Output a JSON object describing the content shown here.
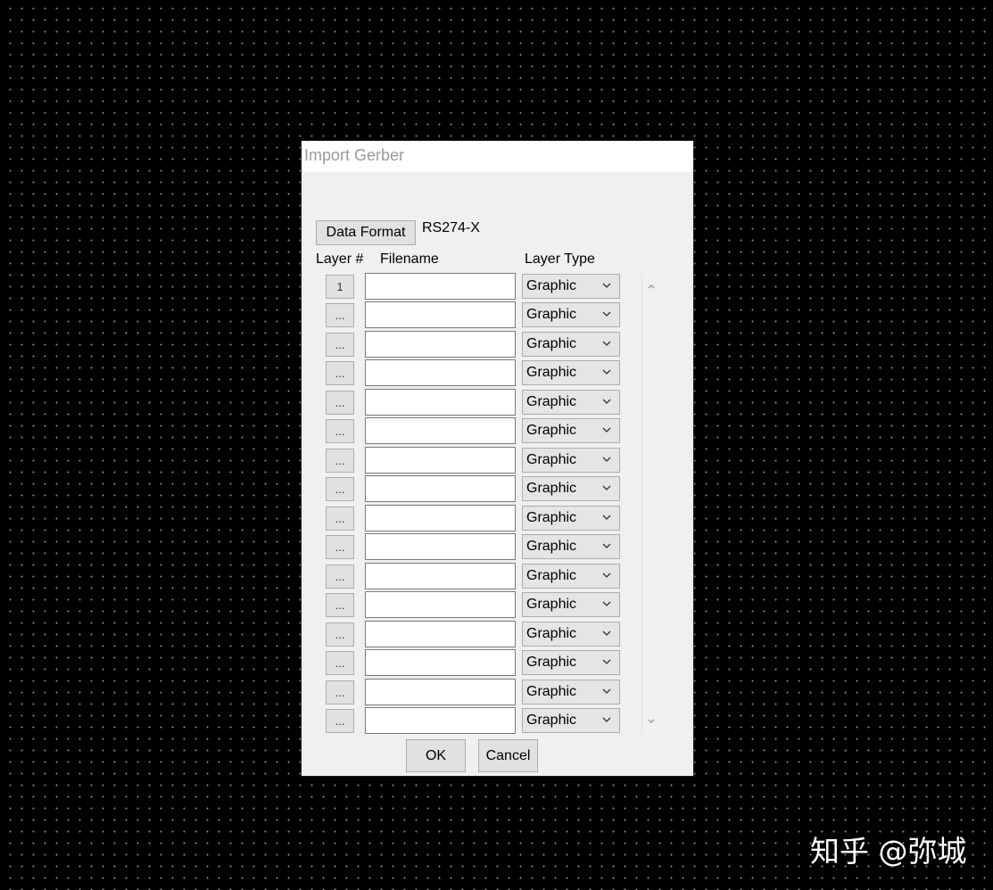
{
  "dialog": {
    "title": "Import Gerber",
    "data_format_button": "Data Format",
    "data_format_value": "RS274-X",
    "columns": {
      "layer": "Layer #",
      "filename": "Filename",
      "layer_type": "Layer Type"
    },
    "rows": [
      {
        "layer": "1",
        "filename": "",
        "layer_type": "Graphic"
      },
      {
        "layer": "...",
        "filename": "",
        "layer_type": "Graphic"
      },
      {
        "layer": "...",
        "filename": "",
        "layer_type": "Graphic"
      },
      {
        "layer": "...",
        "filename": "",
        "layer_type": "Graphic"
      },
      {
        "layer": "...",
        "filename": "",
        "layer_type": "Graphic"
      },
      {
        "layer": "...",
        "filename": "",
        "layer_type": "Graphic"
      },
      {
        "layer": "...",
        "filename": "",
        "layer_type": "Graphic"
      },
      {
        "layer": "...",
        "filename": "",
        "layer_type": "Graphic"
      },
      {
        "layer": "...",
        "filename": "",
        "layer_type": "Graphic"
      },
      {
        "layer": "...",
        "filename": "",
        "layer_type": "Graphic"
      },
      {
        "layer": "...",
        "filename": "",
        "layer_type": "Graphic"
      },
      {
        "layer": "...",
        "filename": "",
        "layer_type": "Graphic"
      },
      {
        "layer": "...",
        "filename": "",
        "layer_type": "Graphic"
      },
      {
        "layer": "...",
        "filename": "",
        "layer_type": "Graphic"
      },
      {
        "layer": "...",
        "filename": "",
        "layer_type": "Graphic"
      },
      {
        "layer": "...",
        "filename": "",
        "layer_type": "Graphic"
      }
    ],
    "ok_button": "OK",
    "cancel_button": "Cancel"
  },
  "icons": {
    "dropdown": "chevron-down-icon",
    "scroll_up": "chevron-up-icon",
    "scroll_down": "chevron-down-icon"
  },
  "watermark": "知乎 @弥城",
  "colors": {
    "background": "#000000",
    "dialog": "#f0f0f0",
    "button": "#e1e1e1",
    "select": "#e5e5e5"
  }
}
